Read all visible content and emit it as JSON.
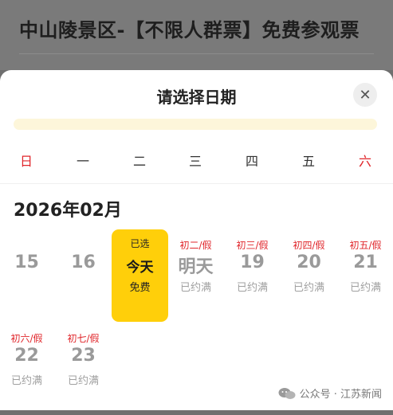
{
  "page": {
    "title": "中山陵景区-【不限人群票】免费参观票"
  },
  "sheet": {
    "title": "请选择日期",
    "close_label": "✕"
  },
  "weekdays": [
    "日",
    "一",
    "二",
    "三",
    "四",
    "五",
    "六"
  ],
  "month": "2026年02月",
  "days": [
    {
      "top": "",
      "main": "15",
      "status": ""
    },
    {
      "top": "",
      "main": "16",
      "status": ""
    },
    {
      "top": "已选",
      "main": "今天",
      "status": "免费",
      "selected": true
    },
    {
      "top": "初二/假",
      "main": "明天",
      "status": "已约满"
    },
    {
      "top": "初三/假",
      "main": "19",
      "status": "已约满"
    },
    {
      "top": "初四/假",
      "main": "20",
      "status": "已约满"
    },
    {
      "top": "初五/假",
      "main": "21",
      "status": "已约满"
    },
    {
      "top": "初六/假",
      "main": "22",
      "status": "已约满"
    },
    {
      "top": "初七/假",
      "main": "23",
      "status": "已约满"
    }
  ],
  "watermark": {
    "text": "公众号 · 江苏新闻",
    "icon": "wechat-icon"
  },
  "colors": {
    "accent": "#ffcf0a",
    "weekend": "#e0262b",
    "notice": "#fdf6da"
  }
}
